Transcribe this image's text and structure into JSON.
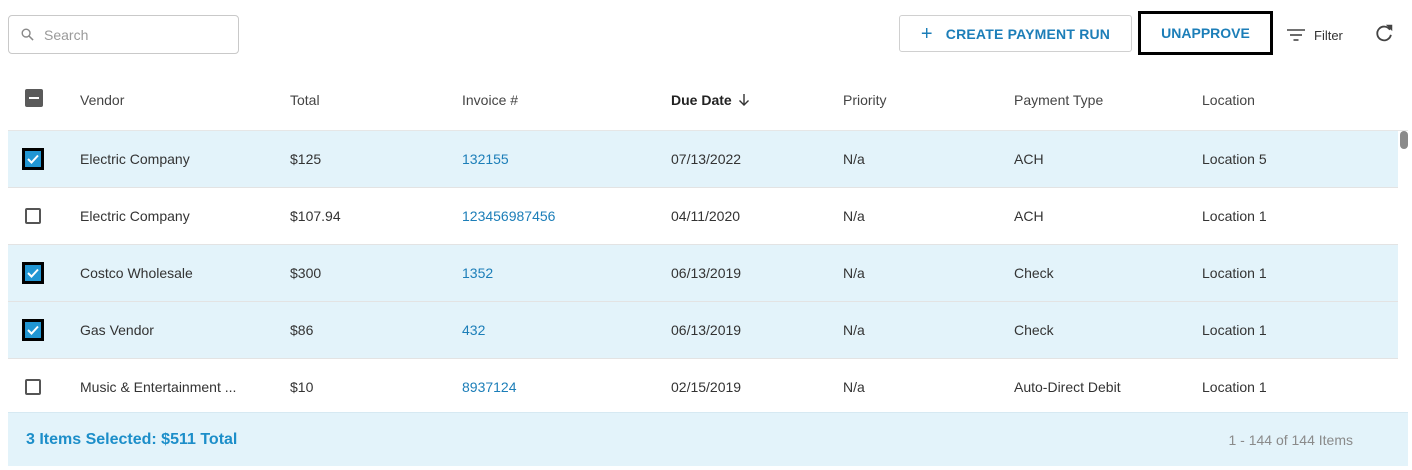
{
  "search": {
    "placeholder": "Search",
    "value": ""
  },
  "toolbar": {
    "create_label": "CREATE PAYMENT RUN",
    "unapprove_label": "UNAPPROVE",
    "filter_label": "Filter"
  },
  "colors": {
    "accent": "#1c7eb8",
    "selected_row": "#e3f3fa",
    "checkbox": "#2196d3"
  },
  "columns": [
    "Vendor",
    "Total",
    "Invoice #",
    "Due Date",
    "Priority",
    "Payment Type",
    "Location"
  ],
  "sort": {
    "column": "Due Date",
    "direction": "descending"
  },
  "rows": [
    {
      "selected": true,
      "vendor": "Electric Company",
      "total": "$125",
      "invoice": "132155",
      "due_date": "07/13/2022",
      "priority": "N/a",
      "payment_type": "ACH",
      "location": "Location 5"
    },
    {
      "selected": false,
      "vendor": "Electric Company",
      "total": "$107.94",
      "invoice": "123456987456",
      "due_date": "04/11/2020",
      "priority": "N/a",
      "payment_type": "ACH",
      "location": "Location 1"
    },
    {
      "selected": true,
      "vendor": "Costco Wholesale",
      "total": "$300",
      "invoice": "1352",
      "due_date": "06/13/2019",
      "priority": "N/a",
      "payment_type": "Check",
      "location": "Location 1"
    },
    {
      "selected": true,
      "vendor": "Gas Vendor",
      "total": "$86",
      "invoice": "432",
      "due_date": "06/13/2019",
      "priority": "N/a",
      "payment_type": "Check",
      "location": "Location 1"
    },
    {
      "selected": false,
      "vendor": "Music & Entertainment ...",
      "total": "$10",
      "invoice": "8937124",
      "due_date": "02/15/2019",
      "priority": "N/a",
      "payment_type": "Auto-Direct Debit",
      "location": "Location 1"
    }
  ],
  "footer": {
    "selection_summary": "3 Items Selected: $511 Total",
    "pager_text": "1 - 144 of 144 Items"
  }
}
